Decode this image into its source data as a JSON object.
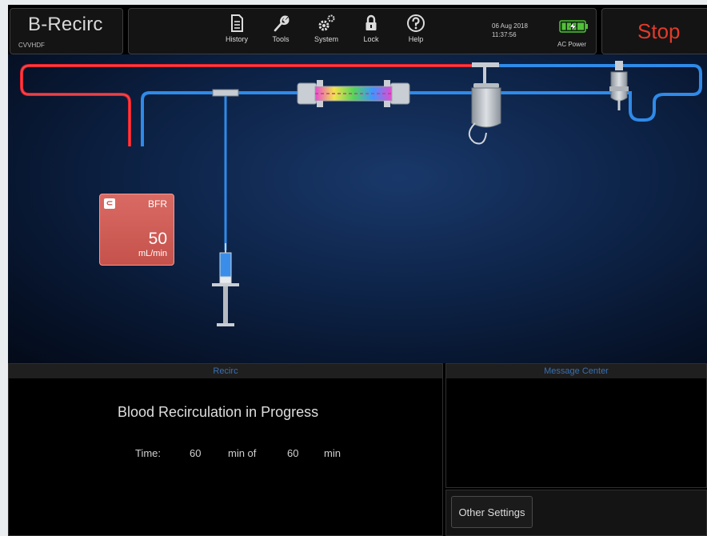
{
  "header": {
    "mode_title": "B-Recirc",
    "mode_subtitle": "CVVHDF",
    "menu": [
      {
        "label": "History",
        "icon": "history-icon"
      },
      {
        "label": "Tools",
        "icon": "wrench-icon"
      },
      {
        "label": "System",
        "icon": "gears-icon"
      },
      {
        "label": "Lock",
        "icon": "lock-icon"
      },
      {
        "label": "Help",
        "icon": "help-icon"
      }
    ],
    "date": "06 Aug 2018",
    "time": "11:37:56",
    "power_label": "AC Power",
    "battery_icon": "battery-charging-icon",
    "stop_label": "Stop"
  },
  "circuit": {
    "pump": {
      "name": "BFR",
      "value": "50",
      "unit": "mL/min",
      "icon": "pump-icon"
    },
    "components": [
      "syringe-icon",
      "filter-icon",
      "bag-icon",
      "air-detector-icon"
    ],
    "colors": {
      "arterial_line": "#e8212a",
      "venous_line": "#2f8ae8",
      "pump_body": "#cf5b54",
      "stop_text": "#e23a2a"
    }
  },
  "recirc_panel": {
    "title": "Recirc",
    "status": "Blood Recirculation in Progress",
    "time_label": "Time:",
    "elapsed": "60",
    "elapsed_unit": "min of",
    "total": "60",
    "total_unit": "min"
  },
  "message_center": {
    "title": "Message Center"
  },
  "other_settings_label": "Other Settings"
}
